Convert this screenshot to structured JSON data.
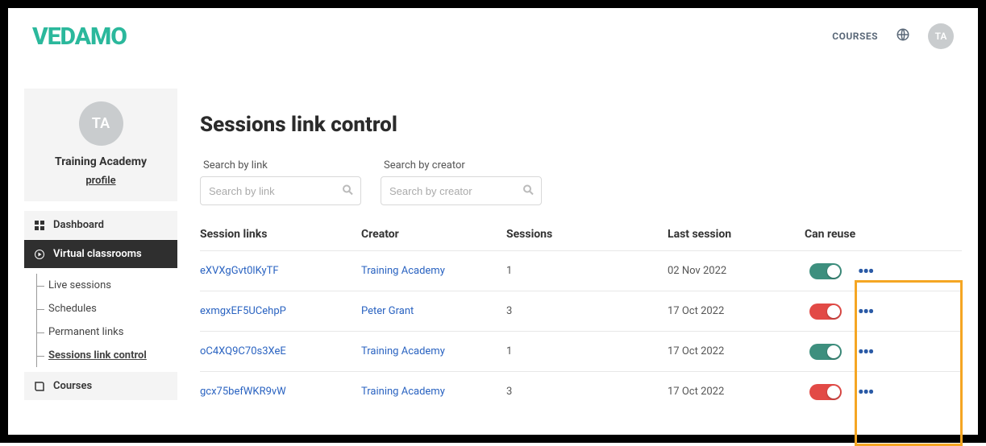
{
  "brand": "VEDAMO",
  "topbar": {
    "courses": "COURSES",
    "avatar_initials": "TA"
  },
  "profile": {
    "avatar_initials": "TA",
    "name": "Training Academy",
    "profile_link": "profile"
  },
  "nav": {
    "dashboard": "Dashboard",
    "virtual_classrooms": "Virtual classrooms",
    "sub": {
      "live_sessions": "Live sessions",
      "schedules": "Schedules",
      "permanent_links": "Permanent links",
      "sessions_link_control": "Sessions link control"
    },
    "courses": "Courses"
  },
  "page": {
    "title": "Sessions link control",
    "search_link_label": "Search by link",
    "search_link_placeholder": "Search by link",
    "search_creator_label": "Search by creator",
    "search_creator_placeholder": "Search by creator"
  },
  "columns": {
    "session_links": "Session links",
    "creator": "Creator",
    "sessions": "Sessions",
    "last_session": "Last session",
    "can_reuse": "Can reuse"
  },
  "rows": [
    {
      "link": "eXVXgGvt0lKyTF",
      "creator": "Training Academy",
      "sessions": "1",
      "last": "02 Nov 2022",
      "reuse": true
    },
    {
      "link": "exmgxEF5UCehpP",
      "creator": "Peter Grant",
      "sessions": "3",
      "last": "17 Oct 2022",
      "reuse": false
    },
    {
      "link": "oC4XQ9C70s3XeE",
      "creator": "Training Academy",
      "sessions": "1",
      "last": "17 Oct 2022",
      "reuse": true
    },
    {
      "link": "gcx75befWKR9vW",
      "creator": "Training Academy",
      "sessions": "3",
      "last": "17 Oct 2022",
      "reuse": false
    }
  ]
}
